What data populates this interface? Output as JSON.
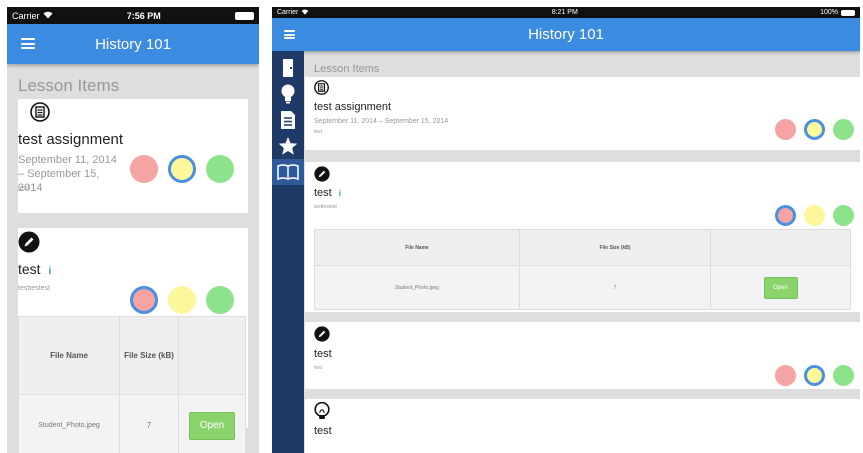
{
  "phone": {
    "status": {
      "carrier": "Carrier",
      "time": "7:56 PM"
    },
    "nav_title": "History 101",
    "section_title": "Lesson Items",
    "items": [
      {
        "title": "test assignment",
        "dates": "September 11, 2014 – September 15, 2014",
        "desc": "test",
        "icon": "assignment-icon"
      },
      {
        "title": "test",
        "desc": "testtestest",
        "icon": "pencil-icon"
      }
    ],
    "table": {
      "headers": [
        "File Name",
        "File Size (kB)",
        ""
      ],
      "rows": [
        {
          "name": "Student_Photo.jpeg",
          "size": "7",
          "action": "Open"
        }
      ]
    }
  },
  "tablet": {
    "status": {
      "carrier": "Carrier",
      "time": "8:21 PM",
      "battery": "100%"
    },
    "nav_title": "History 101",
    "section_title": "Lesson Items",
    "sidebar": [
      "door-icon",
      "lightbulb-icon",
      "document-icon",
      "star-icon",
      "book-icon"
    ],
    "items": [
      {
        "title": "test assignment",
        "dates": "September 11, 2014 – September 15, 2014",
        "desc": "test",
        "icon": "assignment-icon"
      },
      {
        "title": "test",
        "desc": "testtestest",
        "icon": "pencil-icon"
      },
      {
        "title": "test",
        "desc": "test",
        "icon": "pencil-icon"
      },
      {
        "title": "test",
        "icon": "lightbulb-icon"
      }
    ],
    "table": {
      "headers": [
        "File Name",
        "File Size (kB)",
        ""
      ],
      "rows": [
        {
          "name": "Student_Photo.jpeg",
          "size": "7",
          "action": "Open"
        }
      ]
    }
  },
  "colors": {
    "nav": "#3b8be0",
    "sidebar": "#1f3a66",
    "red": "#f5a3a3",
    "yellow": "#fbf79a",
    "green": "#8de28c",
    "selected_ring": "#4a90e2"
  }
}
